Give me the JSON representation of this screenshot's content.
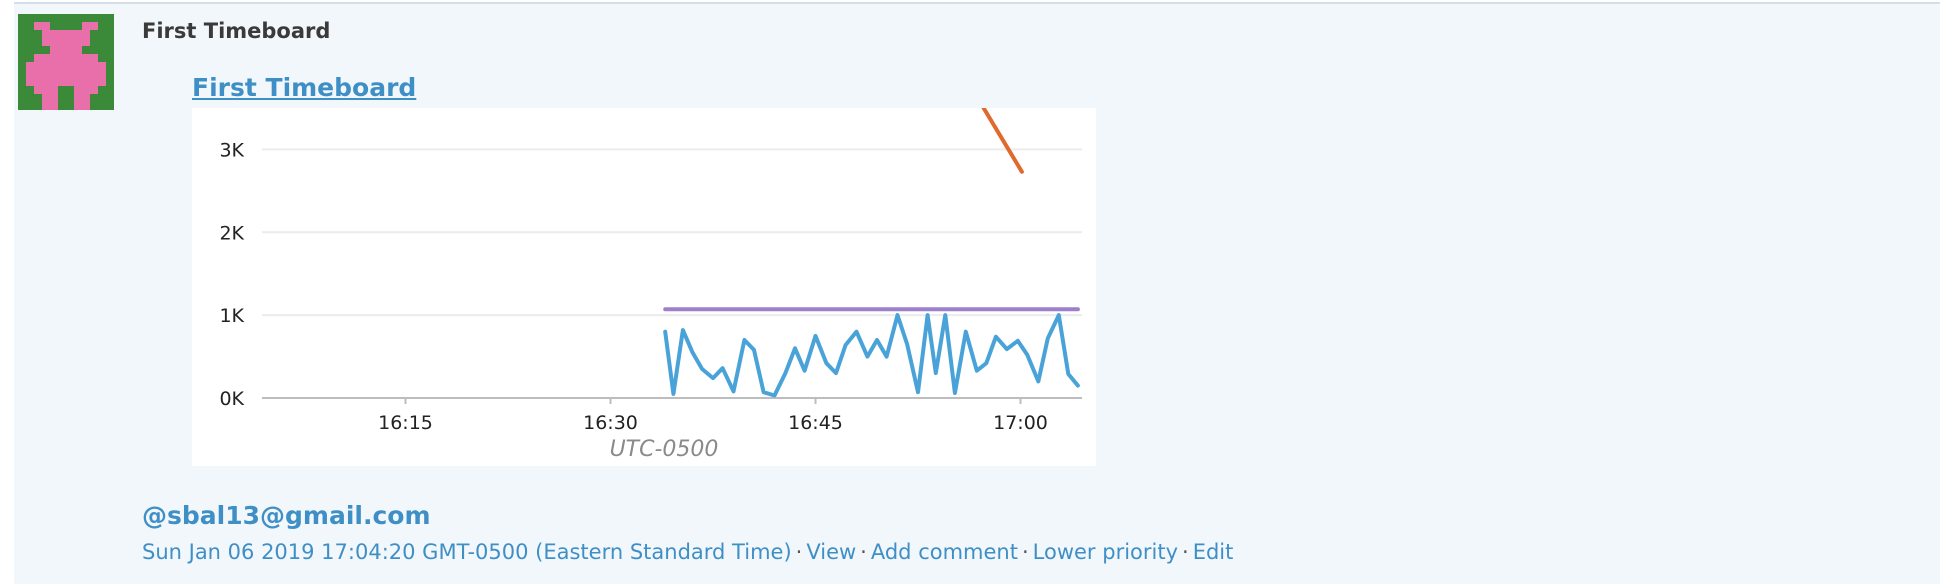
{
  "event": {
    "author": "First Timeboard",
    "snapshot_title": "First Timeboard",
    "mention": "@sbal13@gmail.com",
    "timestamp": "Sun Jan 06 2019 17:04:20 GMT-0500 (Eastern Standard Time)",
    "separator": "·",
    "actions": {
      "view": "View",
      "add_comment": "Add comment",
      "lower_priority": "Lower priority",
      "edit": "Edit"
    }
  },
  "avatar": {
    "icon": "pixel-invader-icon",
    "background_color": "#3a8a3a",
    "foreground_color": "#e86faa"
  },
  "chart_data": {
    "type": "line",
    "title": "",
    "xlabel": "UTC-0500",
    "ylabel": "",
    "x_ticks": [
      "16:15",
      "16:30",
      "16:45",
      "17:00"
    ],
    "x_tick_minutes": [
      15,
      30,
      45,
      60
    ],
    "xlim_minutes_after_1600": [
      4.5,
      64.5
    ],
    "y_ticks": [
      "0K",
      "1K",
      "2K",
      "3K"
    ],
    "y_tick_values": [
      0,
      1000,
      2000,
      3000
    ],
    "ylim": [
      0,
      3500
    ],
    "grid": true,
    "series": [
      {
        "color": "#4aa3d8",
        "x": [
          34.0,
          34.6,
          35.3,
          36.0,
          36.7,
          37.5,
          38.2,
          39.0,
          39.8,
          40.5,
          41.2,
          42.0,
          42.8,
          43.5,
          44.2,
          45.0,
          45.8,
          46.5,
          47.2,
          48.0,
          48.8,
          49.5,
          50.2,
          51.0,
          51.7,
          52.5,
          53.2,
          53.8,
          54.5,
          55.2,
          56.0,
          56.8,
          57.5,
          58.2,
          59.0,
          59.8,
          60.5,
          61.3,
          62.0,
          62.8,
          63.5,
          64.2
        ],
        "y": [
          800,
          50,
          820,
          550,
          350,
          240,
          360,
          80,
          700,
          580,
          70,
          30,
          300,
          600,
          330,
          750,
          420,
          300,
          640,
          800,
          500,
          700,
          500,
          1000,
          650,
          70,
          1000,
          300,
          1000,
          60,
          800,
          330,
          420,
          740,
          590,
          690,
          520,
          200,
          720,
          1000,
          290,
          150
        ]
      },
      {
        "color": "#9d7fcc",
        "x": [
          34.0,
          64.2
        ],
        "y": [
          1070,
          1070
        ]
      },
      {
        "color": "#e06a2c",
        "x": [
          57.3,
          60.1
        ],
        "y": [
          3500,
          2730
        ]
      }
    ]
  }
}
